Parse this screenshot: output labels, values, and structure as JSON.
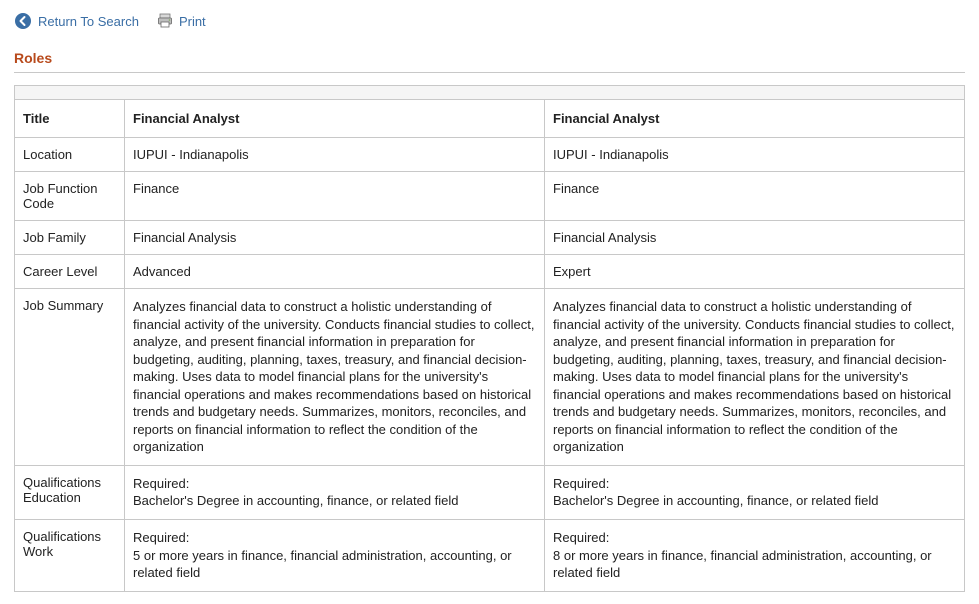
{
  "toolbar": {
    "return_label": "Return To Search",
    "print_label": "Print"
  },
  "section": {
    "title": "Roles"
  },
  "table": {
    "rows": [
      {
        "label": "Title",
        "col1": "Financial Analyst",
        "col2": "Financial Analyst"
      },
      {
        "label": "Location",
        "col1": "IUPUI - Indianapolis",
        "col2": "IUPUI - Indianapolis"
      },
      {
        "label": "Job Function Code",
        "col1": "Finance",
        "col2": "Finance"
      },
      {
        "label": "Job Family",
        "col1": "Financial Analysis",
        "col2": "Financial Analysis"
      },
      {
        "label": "Career Level",
        "col1": "Advanced",
        "col2": "Expert"
      },
      {
        "label": "Job Summary",
        "col1": "Analyzes financial data to construct a holistic understanding of financial activity of the university. Conducts financial studies to collect, analyze, and present financial information in preparation for budgeting, auditing, planning, taxes, treasury, and financial decision-making. Uses data to model financial plans for the university's financial operations and makes recommendations based on historical trends and budgetary needs. Summarizes, monitors, reconciles, and reports on financial information to reflect the condition of the organization",
        "col2": "Analyzes financial data to construct a holistic understanding of financial activity of the university. Conducts financial studies to collect, analyze, and present financial information in preparation for budgeting, auditing, planning, taxes, treasury, and financial decision-making. Uses data to model financial plans for the university's financial operations and makes recommendations based on historical trends and budgetary needs. Summarizes, monitors, reconciles, and reports on financial information to reflect the condition of the organization"
      },
      {
        "label": "Qualifications Education",
        "col1": "Required:\nBachelor's Degree in accounting, finance, or related field",
        "col2": "Required:\nBachelor's Degree in accounting, finance, or related field"
      },
      {
        "label": "Qualifications Work",
        "col1": "Required:\n5 or more years in finance, financial administration, accounting, or related field",
        "col2": "Required:\n8 or more years in finance, financial administration, accounting, or related field"
      }
    ]
  }
}
